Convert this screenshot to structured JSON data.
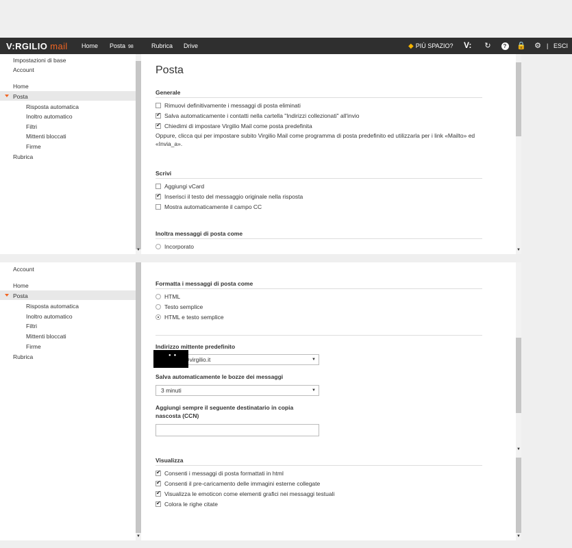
{
  "topbar": {
    "logo_main": "V:RGILIO",
    "logo_sub": "mail",
    "nav": [
      "Home",
      "Posta",
      "Rubrica",
      "Drive"
    ],
    "posta_badge": "98",
    "promo": "PIÙ SPAZIO?",
    "vi": "V:",
    "separator": "|",
    "logout": "ESCI"
  },
  "sidebar_top": {
    "items": [
      "Impostazioni di base",
      "Account",
      "Home",
      "Posta",
      "Risposta automatica",
      "Inoltro automatico",
      "Filtri",
      "Mittenti bloccati",
      "Firme",
      "Rubrica"
    ]
  },
  "sidebar_bottom": {
    "items": [
      "Account",
      "Home",
      "Posta",
      "Risposta automatica",
      "Inoltro automatico",
      "Filtri",
      "Mittenti bloccati",
      "Firme",
      "Rubrica"
    ]
  },
  "page": {
    "title": "Posta",
    "generale": {
      "title": "Generale",
      "opt1": "Rimuovi definitivamente i messaggi di posta eliminati",
      "opt2": "Salva automaticamente i contatti nella cartella \"Indirizzi collezionati\" all'invio",
      "opt3": "Chiedimi di impostare Virgilio Mail come posta predefinita",
      "para": "Oppure, clicca qui per impostare subito Virgilio Mail come programma di posta predefinito ed utilizzarla per i link «Mailto» ed «Invia_a»."
    },
    "scrivi": {
      "title": "Scrivi",
      "opt1": "Aggiungi vCard",
      "opt2": "Inserisci il testo del messaggio originale nella risposta",
      "opt3": "Mostra automaticamente il campo CC"
    },
    "inoltra": {
      "title": "Inoltra messaggi di posta come",
      "opt1": "Incorporato"
    },
    "formatta": {
      "title": "Formatta i messaggi di posta come",
      "opt1": "HTML",
      "opt2": "Testo semplice",
      "opt3": "HTML e testo semplice"
    },
    "mittente": {
      "label": "Indirizzo mittente predefinito",
      "value": "@virgilio.it"
    },
    "bozze": {
      "label": "Salva automaticamente le bozze dei messaggi",
      "value": "3 minuti"
    },
    "ccn": {
      "label": "Aggiungi sempre il seguente destinatario in copia nascosta (CCN)",
      "value": ""
    },
    "visualizza": {
      "title": "Visualizza",
      "opt1": "Consenti i messaggi di posta formattati in html",
      "opt2": "Consenti il pre-caricamento delle immagini esterne collegate",
      "opt3": "Visualizza le emoticon come elementi grafici nei messaggi testuali",
      "opt4": "Colora le righe citate"
    }
  }
}
